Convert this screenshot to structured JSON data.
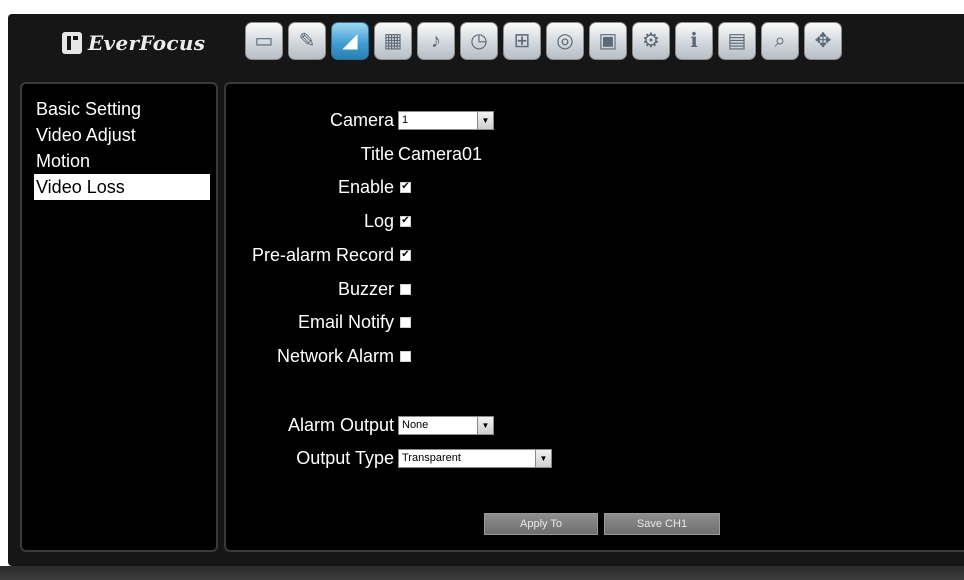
{
  "brand": {
    "logo_text": "EverFocus"
  },
  "toolbar": {
    "icons": [
      {
        "name": "monitor-icon",
        "glyph": "▭"
      },
      {
        "name": "tools-icon",
        "glyph": "✎"
      },
      {
        "name": "camera-icon",
        "glyph": "◢",
        "active": true
      },
      {
        "name": "film-icon",
        "glyph": "▦"
      },
      {
        "name": "alarm-icon",
        "glyph": "♪"
      },
      {
        "name": "schedule-icon",
        "glyph": "◷"
      },
      {
        "name": "network-icon",
        "glyph": "⊞"
      },
      {
        "name": "disk-icon",
        "glyph": "◎"
      },
      {
        "name": "display-icon",
        "glyph": "▣"
      },
      {
        "name": "gear-icon",
        "glyph": "⚙"
      },
      {
        "name": "info-icon",
        "glyph": "ℹ"
      },
      {
        "name": "playback-icon",
        "glyph": "▤"
      },
      {
        "name": "search-icon",
        "glyph": "⌕"
      },
      {
        "name": "move-icon",
        "glyph": "✥"
      }
    ],
    "accent": "#3b9bd0"
  },
  "sidebar": {
    "items": [
      {
        "label": "Basic Setting",
        "selected": false
      },
      {
        "label": "Video Adjust",
        "selected": false
      },
      {
        "label": "Motion",
        "selected": false
      },
      {
        "label": "Video Loss",
        "selected": true
      }
    ]
  },
  "form": {
    "camera": {
      "label": "Camera",
      "value": "1"
    },
    "title": {
      "label": "Title",
      "value": "Camera01"
    },
    "enable": {
      "label": "Enable",
      "checked": true
    },
    "log": {
      "label": "Log",
      "checked": true
    },
    "prealarm": {
      "label": "Pre-alarm Record",
      "checked": true
    },
    "buzzer": {
      "label": "Buzzer",
      "checked": false
    },
    "email": {
      "label": "Email Notify",
      "checked": false
    },
    "network": {
      "label": "Network Alarm",
      "checked": false
    },
    "alarm_output": {
      "label": "Alarm Output",
      "value": "None"
    },
    "output_type": {
      "label": "Output Type",
      "value": "Transparent"
    }
  },
  "buttons": {
    "apply_to": "Apply To",
    "save_ch": "Save CH1"
  }
}
